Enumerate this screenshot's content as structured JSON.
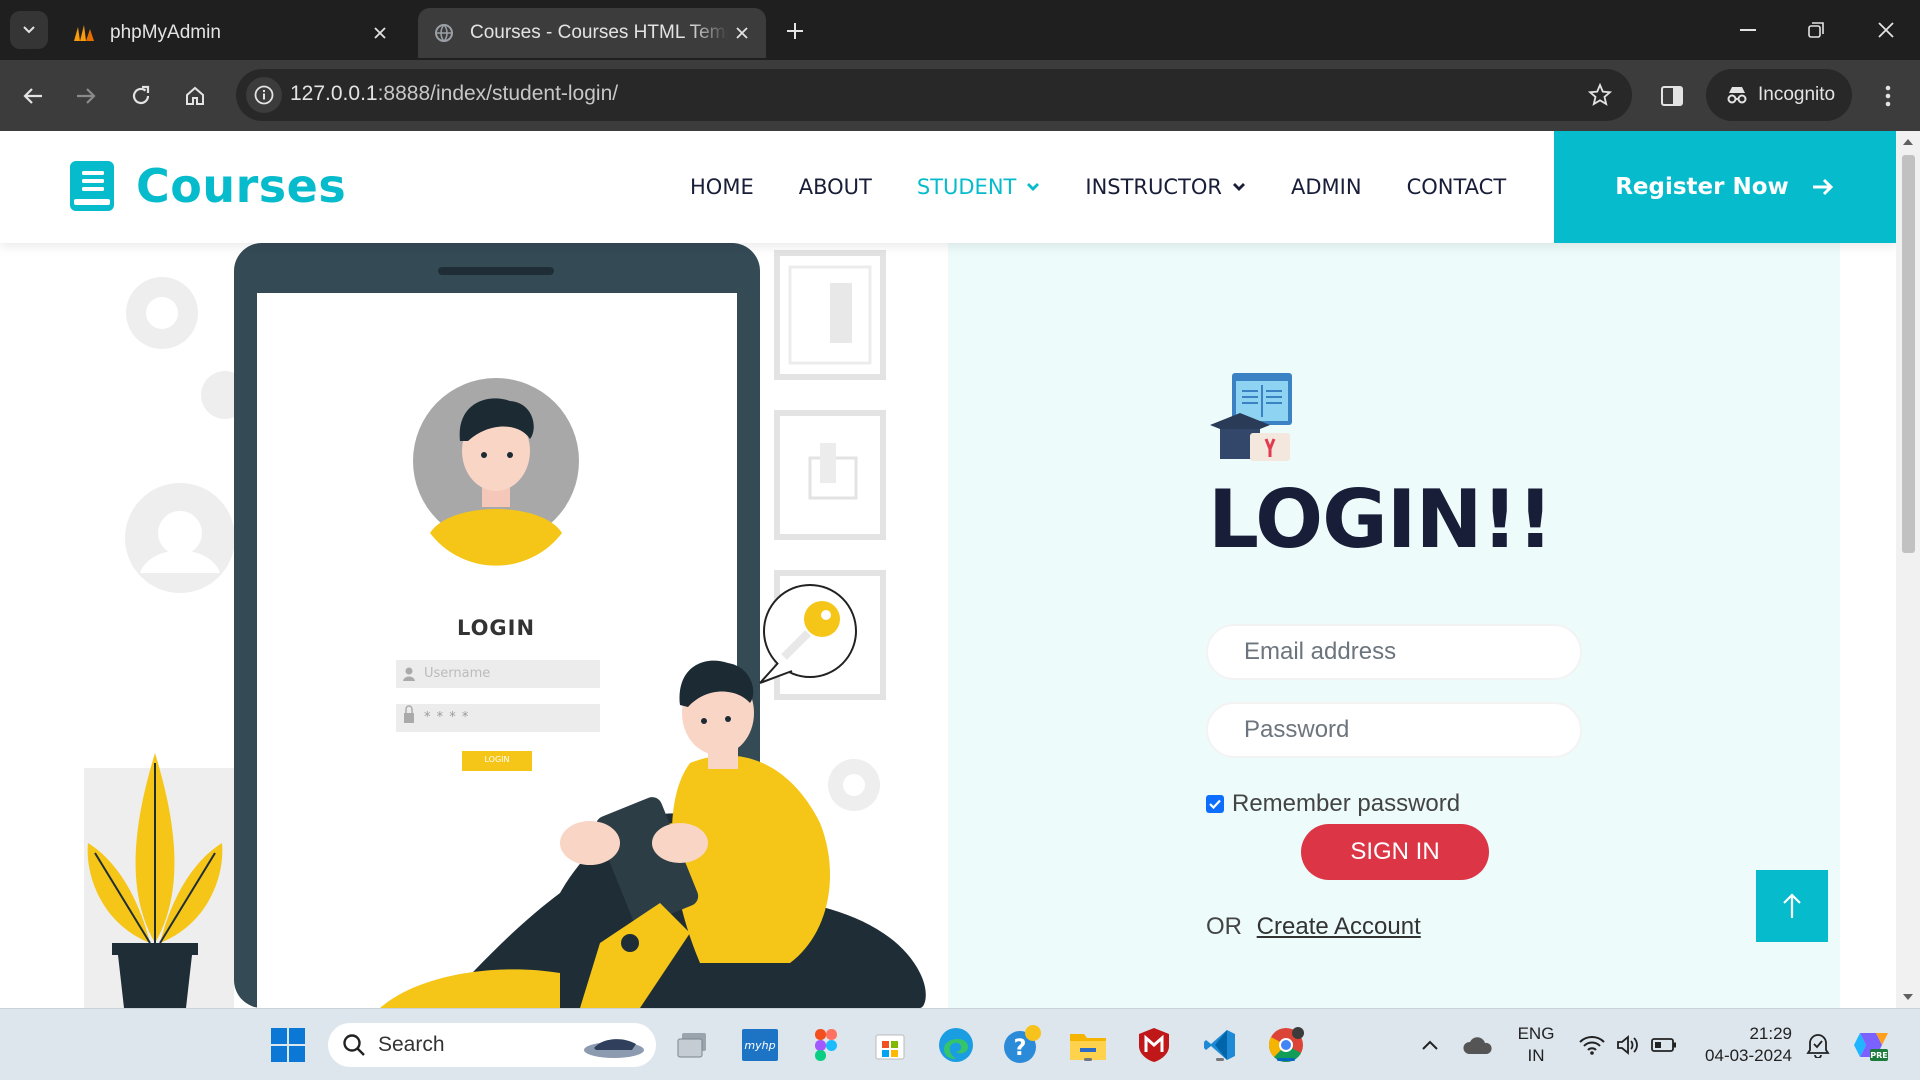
{
  "browser": {
    "tabs": [
      {
        "title": "phpMyAdmin",
        "active": false,
        "favicon": "phpmyadmin-icon"
      },
      {
        "title": "Courses - Courses HTML Template",
        "active": true,
        "favicon": "globe-icon"
      }
    ],
    "url_host": "127.0.0.1",
    "url_path": ":8888/index/student-login/",
    "incognito_label": "Incognito"
  },
  "site": {
    "brand": "Courses",
    "nav": {
      "home": "HOME",
      "about": "ABOUT",
      "student": "STUDENT",
      "instructor": "INSTRUCTOR",
      "admin": "ADMIN",
      "contact": "CONTACT"
    },
    "register_label": "Register Now",
    "accent_color": "#06bbcc"
  },
  "illustration": {
    "login_caption": "LOGIN",
    "username_placeholder": "Username",
    "password_dots": "* * * *",
    "login_button": "LOGIN"
  },
  "login_form": {
    "title": "LOGIN!!",
    "email_placeholder": "Email address",
    "password_placeholder": "Password",
    "remember_label": "Remember password",
    "remember_checked": true,
    "signin_label": "SIGN IN",
    "or_text": "OR",
    "create_account_label": "Create Account"
  },
  "taskbar": {
    "search_label": "Search",
    "language_line1": "ENG",
    "language_line2": "IN",
    "time": "21:29",
    "date": "04-03-2024"
  }
}
